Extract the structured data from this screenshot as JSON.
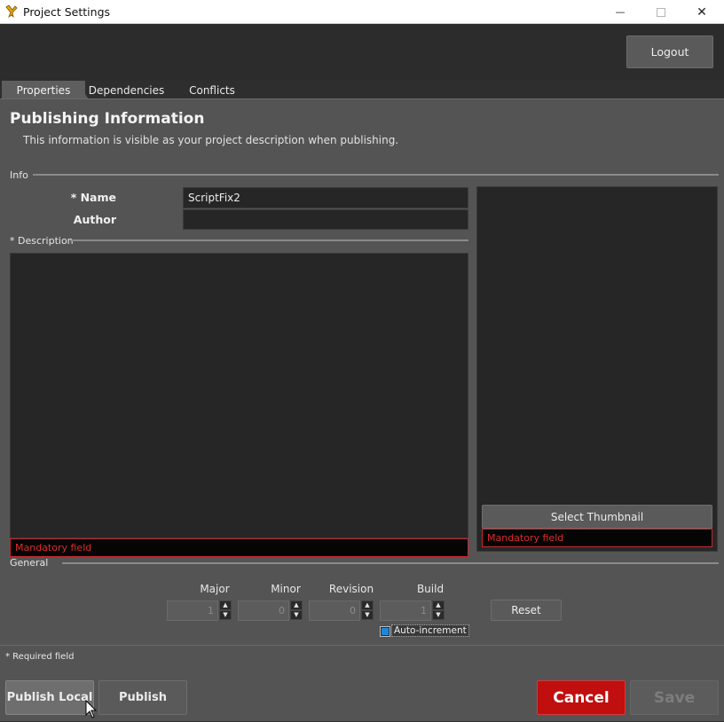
{
  "window": {
    "title": "Project Settings",
    "minimize_glyph": "—",
    "close_glyph": "✕"
  },
  "header": {
    "logout_label": "Logout"
  },
  "tabs": [
    {
      "label": "Properties",
      "active": true
    },
    {
      "label": "Dependencies",
      "active": false
    },
    {
      "label": "Conflicts",
      "active": false
    }
  ],
  "publishing": {
    "title": "Publishing Information",
    "subtitle": "This information is visible as your project description when publishing."
  },
  "info": {
    "section_label": "Info",
    "name_label": "* Name",
    "name_value": "ScriptFix2",
    "author_label": "Author",
    "author_value": "",
    "description_label": "* Description",
    "description_value": "",
    "description_error": "Mandatory field"
  },
  "thumbnail": {
    "select_label": "Select Thumbnail",
    "error": "Mandatory field"
  },
  "general": {
    "section_label": "General",
    "version": {
      "major_label": "Major",
      "major_value": "1",
      "minor_label": "Minor",
      "minor_value": "0",
      "revision_label": "Revision",
      "revision_value": "0",
      "build_label": "Build",
      "build_value": "1"
    },
    "reset_label": "Reset",
    "auto_increment_label": "Auto-increment",
    "auto_increment_checked": true
  },
  "footer": {
    "required_note": "* Required field",
    "publish_local_label": "Publish Local",
    "publish_label": "Publish",
    "cancel_label": "Cancel",
    "save_label": "Save"
  },
  "colors": {
    "cancel": "#c10e0e",
    "error_border": "#c8282e",
    "checkbox": "#1e88d8"
  }
}
